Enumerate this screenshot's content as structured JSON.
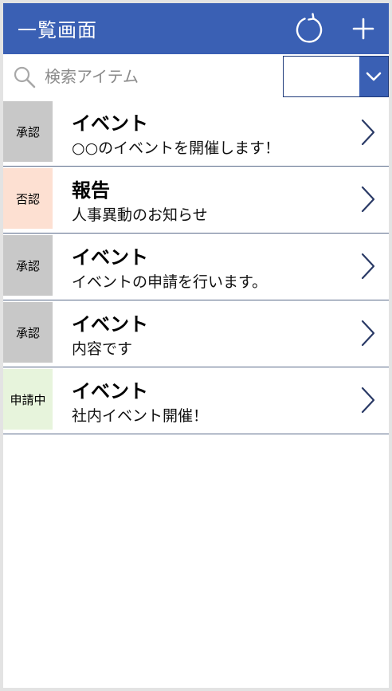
{
  "header": {
    "title": "一覧画面",
    "refresh_icon": "refresh-icon",
    "add_icon": "plus-icon"
  },
  "search": {
    "placeholder": "検索アイテム",
    "value": ""
  },
  "filter": {
    "selected": ""
  },
  "colors": {
    "header": "#3a60b4",
    "approved": "#c8c8c8",
    "rejected": "#fde0d2",
    "pending": "#e7f4dc"
  },
  "items": [
    {
      "status": "承認",
      "title": "イベント",
      "subtitle": "○○のイベントを開催します！"
    },
    {
      "status": "否認",
      "title": "報告",
      "subtitle": "人事異動のお知らせ"
    },
    {
      "status": "承認",
      "title": "イベント",
      "subtitle": "イベントの申請を行います。"
    },
    {
      "status": "承認",
      "title": "イベント",
      "subtitle": "内容です"
    },
    {
      "status": "申請中",
      "title": "イベント",
      "subtitle": "社内イベント開催！"
    }
  ]
}
